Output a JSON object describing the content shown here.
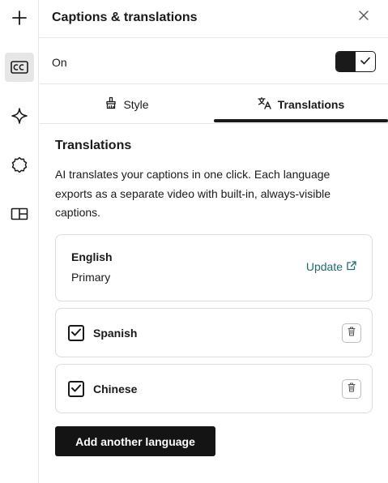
{
  "rail": {
    "items": [
      {
        "icon": "plus-icon"
      },
      {
        "icon": "closed-captions-icon",
        "active": true
      },
      {
        "icon": "sparkle-icon"
      },
      {
        "icon": "badge-icon"
      },
      {
        "icon": "layout-icon"
      }
    ]
  },
  "header": {
    "title": "Captions & translations",
    "close_icon": "close-icon"
  },
  "captions": {
    "on_label": "On",
    "enabled": true
  },
  "tabs": [
    {
      "label": "Style",
      "icon": "brush-icon",
      "active": false
    },
    {
      "label": "Translations",
      "icon": "translate-icon",
      "active": true
    }
  ],
  "translations": {
    "title": "Translations",
    "description": "AI translates your captions in one click. Each language exports as a separate video with built-in, always-visible captions.",
    "primary": {
      "name": "English",
      "sub": "Primary",
      "update_label": "Update",
      "update_icon": "external-link-icon"
    },
    "languages": [
      {
        "name": "Spanish",
        "checked": true
      },
      {
        "name": "Chinese",
        "checked": true
      }
    ],
    "add_button": "Add another language"
  },
  "colors": {
    "accent": "#1f6b6e",
    "primary_dark": "#141414",
    "border": "#dcdcdc"
  }
}
